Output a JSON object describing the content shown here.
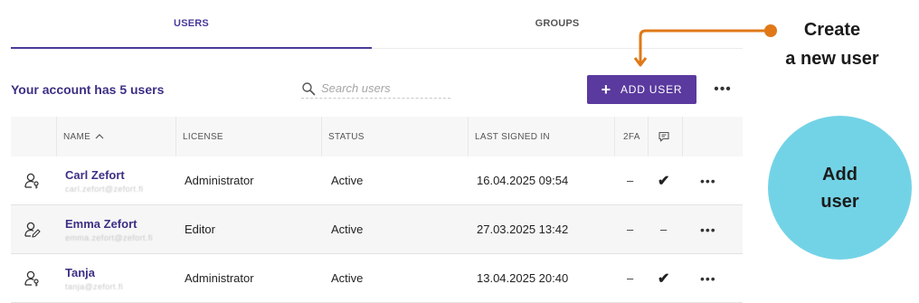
{
  "tabs": {
    "users": "USERS",
    "groups": "GROUPS"
  },
  "account_summary": "Your account has 5 users",
  "search": {
    "placeholder": "Search users"
  },
  "add_user_label": "ADD USER",
  "more_icon": "•••",
  "table": {
    "headers": {
      "name": "NAME",
      "sort_indicator": "^",
      "license": "LICENSE",
      "status": "STATUS",
      "last_signed_in": "LAST SIGNED IN",
      "two_fa": "2FA"
    },
    "rows": [
      {
        "name": "Carl Zefort",
        "email": "carl.zefort@zefort.fi",
        "license": "Administrator",
        "status": "Active",
        "last_signed_in": "16.04.2025 09:54",
        "two_fa": "–",
        "chat": "✔",
        "more": "•••"
      },
      {
        "name": "Emma Zefort",
        "email": "emma.zefort@zefort.fi",
        "license": "Editor",
        "status": "Active",
        "last_signed_in": "27.03.2025 13:42",
        "two_fa": "–",
        "chat": "–",
        "more": "•••"
      },
      {
        "name": "Tanja",
        "email": "tanja@zefort.fi",
        "license": "Administrator",
        "status": "Active",
        "last_signed_in": "13.04.2025 20:40",
        "two_fa": "–",
        "chat": "✔",
        "more": "•••"
      }
    ]
  },
  "annotations": {
    "create_line1": "Create",
    "create_line2": "a new user",
    "circle_line1": "Add",
    "circle_line2": "user"
  },
  "colors": {
    "brand_purple": "#5a3a9e",
    "annotation_orange": "#e07818",
    "circle_cyan": "#73d3e6"
  }
}
